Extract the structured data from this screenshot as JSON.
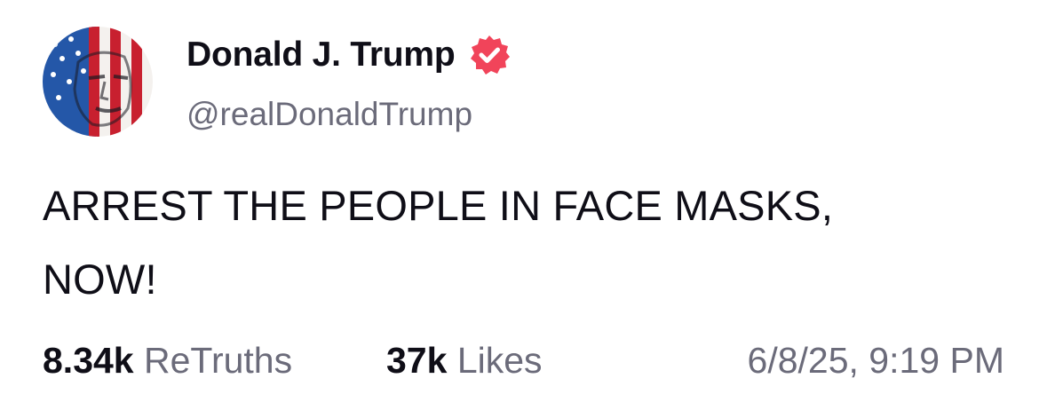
{
  "post": {
    "author": {
      "display_name": "Donald J. Trump",
      "handle": "@realDonaldTrump",
      "verified_icon": "verified-badge-icon",
      "avatar": "avatar-flag-portrait"
    },
    "text_line1": "ARREST THE PEOPLE IN FACE MASKS,",
    "text_line2": "NOW!",
    "stats": {
      "retruths_count": "8.34k",
      "retruths_label": "ReTruths",
      "likes_count": "37k",
      "likes_label": "Likes"
    },
    "timestamp": "6/8/25, 9:19 PM"
  },
  "colors": {
    "text": "#0f0e17",
    "muted": "#6b6b7a",
    "verified": "#f1445a",
    "flag_red": "#c8202f",
    "flag_blue": "#2457a8"
  }
}
